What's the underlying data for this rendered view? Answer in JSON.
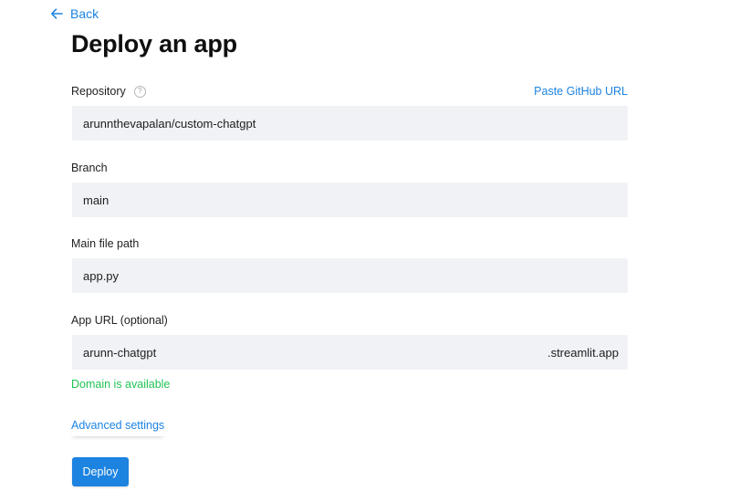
{
  "nav": {
    "back_label": "Back"
  },
  "page": {
    "title": "Deploy an app"
  },
  "repository": {
    "label": "Repository",
    "help_glyph": "?",
    "paste_link": "Paste GitHub URL",
    "value": "arunnthevapalan/custom-chatgpt"
  },
  "branch": {
    "label": "Branch",
    "value": "main"
  },
  "main_file": {
    "label": "Main file path",
    "value": "app.py"
  },
  "app_url": {
    "label": "App URL (optional)",
    "value": "arunn-chatgpt",
    "suffix": ".streamlit.app",
    "status": "Domain is available"
  },
  "advanced": {
    "label": "Advanced settings"
  },
  "actions": {
    "deploy_label": "Deploy"
  },
  "colors": {
    "accent": "#1c83e1",
    "success": "#21c354",
    "input_bg": "#f0f2f6"
  },
  "icons": {
    "back": "arrow-left-icon",
    "help": "question-circle-icon"
  }
}
